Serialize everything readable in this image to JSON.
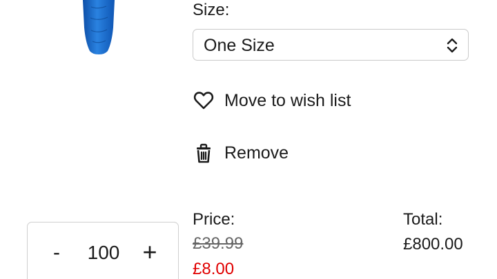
{
  "product": {
    "image_icon": "sleeping-bag-image",
    "image_color": "#1f6fd1"
  },
  "size": {
    "label": "Size:",
    "selected": "One Size",
    "icon": "chevron-up-down-icon"
  },
  "actions": {
    "wishlist_label": "Move to wish list",
    "wishlist_icon": "heart-icon",
    "remove_label": "Remove",
    "remove_icon": "trash-icon"
  },
  "quantity": {
    "minus_label": "-",
    "value": "100",
    "plus_label": "+"
  },
  "price": {
    "label": "Price:",
    "original": "£39.99",
    "sale": "£8.00",
    "sale_color": "#e00000"
  },
  "total": {
    "label": "Total:",
    "value": "£800.00"
  }
}
